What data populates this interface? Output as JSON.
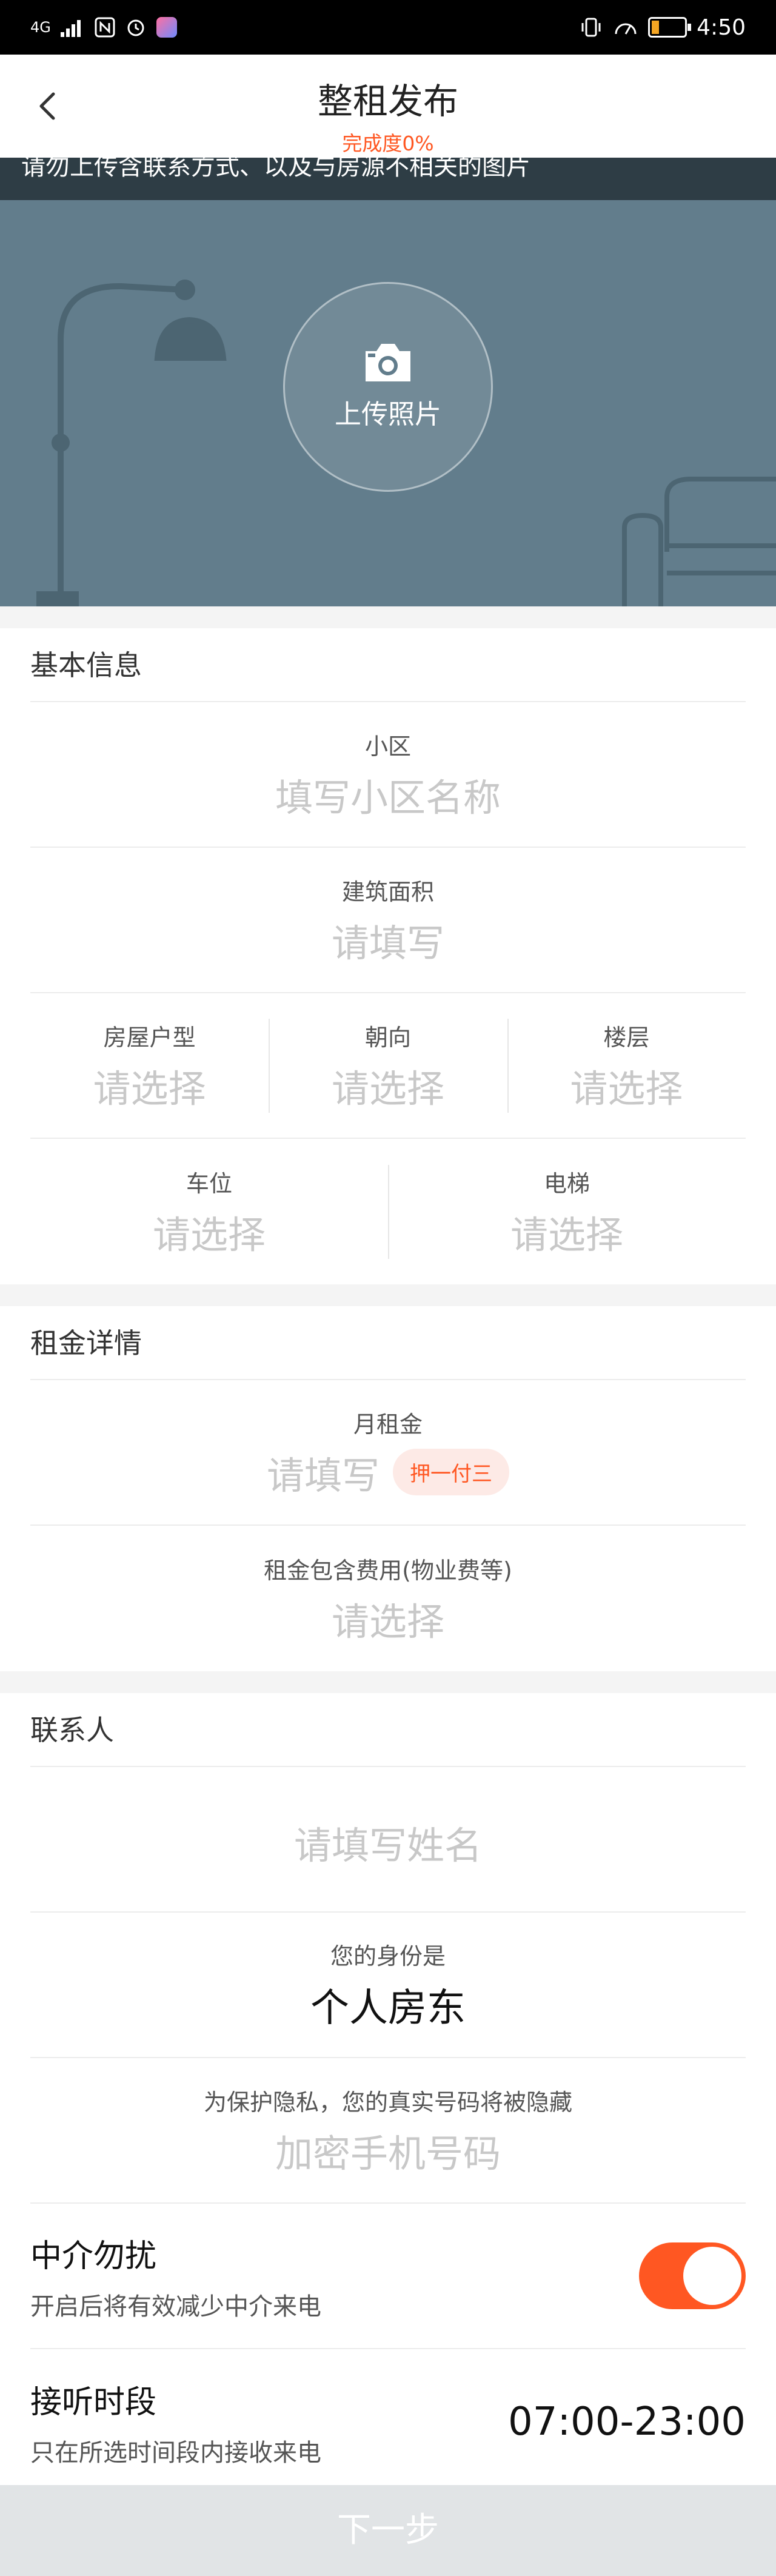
{
  "status_bar": {
    "network": "4G",
    "time": "4:50"
  },
  "nav": {
    "title": "整租发布",
    "subtitle": "完成度0%"
  },
  "banner": {
    "notice": "请勿上传含联系方式、以及与房源不相关的图片",
    "upload_label": "上传照片"
  },
  "basic": {
    "header": "基本信息",
    "community": {
      "label": "小区",
      "placeholder": "填写小区名称"
    },
    "area": {
      "label": "建筑面积",
      "placeholder": "请填写"
    },
    "layout": {
      "label": "房屋户型",
      "placeholder": "请选择"
    },
    "orientation": {
      "label": "朝向",
      "placeholder": "请选择"
    },
    "floor": {
      "label": "楼层",
      "placeholder": "请选择"
    },
    "parking": {
      "label": "车位",
      "placeholder": "请选择"
    },
    "elevator": {
      "label": "电梯",
      "placeholder": "请选择"
    }
  },
  "rent": {
    "header": "租金详情",
    "monthly": {
      "label": "月租金",
      "placeholder": "请填写",
      "tag": "押一付三"
    },
    "includes": {
      "label": "租金包含费用(物业费等)",
      "placeholder": "请选择"
    }
  },
  "contact": {
    "header": "联系人",
    "name": {
      "placeholder": "请填写姓名"
    },
    "identity": {
      "label": "您的身份是",
      "value": "个人房东"
    },
    "phone": {
      "label": "为保护隐私，您的真实号码将被隐藏",
      "placeholder": "加密手机号码"
    },
    "no_agent": {
      "title": "中介勿扰",
      "desc": "开启后将有效减少中介来电",
      "on": true
    },
    "hours": {
      "title": "接听时段",
      "desc": "只在所选时间段内接收来电",
      "value": "07:00-23:00"
    }
  },
  "footer": {
    "next_label": "下一步"
  },
  "colors": {
    "accent": "#ff5722",
    "banner": "#627d8c"
  }
}
